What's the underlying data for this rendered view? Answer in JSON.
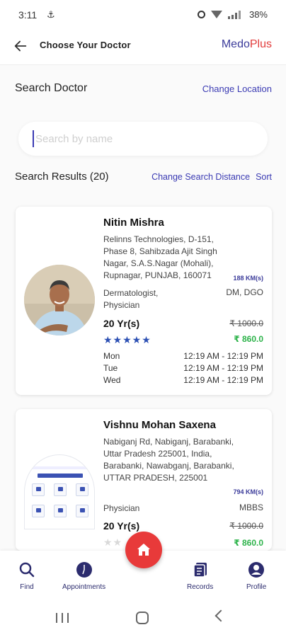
{
  "status_bar": {
    "time": "3:11",
    "notif_symbol": "⚓",
    "battery": "38%"
  },
  "header": {
    "title": "Choose Your Doctor",
    "brand_part1": "Medo",
    "brand_part2": "Plus"
  },
  "search": {
    "section_title": "Search Doctor",
    "change_location": "Change Location",
    "placeholder": "Search by name",
    "value": ""
  },
  "results": {
    "title": "Search Results (20)",
    "change_distance": "Change Search Distance",
    "sort": "Sort"
  },
  "doctors": [
    {
      "name": "Nitin Mishra",
      "address": "Relinns Technologies, D-151, Phase 8, Sahibzada Ajit Singh Nagar, S.A.S.Nagar (Mohali), Rupnagar, PUNJAB, 160071",
      "distance": "188 KM(s)",
      "specialization": "Dermatologist, Physician",
      "degree": "DM, DGO",
      "experience": "20 Yr(s)",
      "fee_original": "₹ 1000.0",
      "fee_discounted": "₹ 860.0",
      "stars": "★★★★★",
      "rating": 5,
      "schedule": [
        {
          "day": "Mon",
          "time": "12:19 AM - 12:19 PM"
        },
        {
          "day": "Tue",
          "time": "12:19 AM - 12:19 PM"
        },
        {
          "day": "Wed",
          "time": "12:19 AM - 12:19 PM"
        }
      ]
    },
    {
      "name": "Vishnu Mohan Saxena",
      "address": "Nabiganj Rd, Nabiganj, Barabanki, Uttar Pradesh 225001, India, Barabanki, Nawabganj, Barabanki, UTTAR PRADESH, 225001",
      "distance": "794 KM(s)",
      "specialization": "Physician",
      "degree": "MBBS",
      "experience": "20 Yr(s)",
      "fee_original": "₹ 1000.0",
      "fee_discounted": "₹ 860.0",
      "stars": "★★",
      "rating": 0
    }
  ],
  "bottom_nav": {
    "find": "Find",
    "appointments": "Appointments",
    "records": "Records",
    "profile": "Profile"
  },
  "colors": {
    "brand_blue": "#3b3b9a",
    "brand_red": "#e23b3b",
    "link": "#3b3bb3",
    "price_green": "#2db34a",
    "fab": "#e83a3a",
    "nav_icon": "#2c2c6e"
  },
  "icons": [
    "back-arrow-icon",
    "search-icon",
    "appointments-icon",
    "home-icon",
    "records-icon",
    "profile-icon"
  ]
}
